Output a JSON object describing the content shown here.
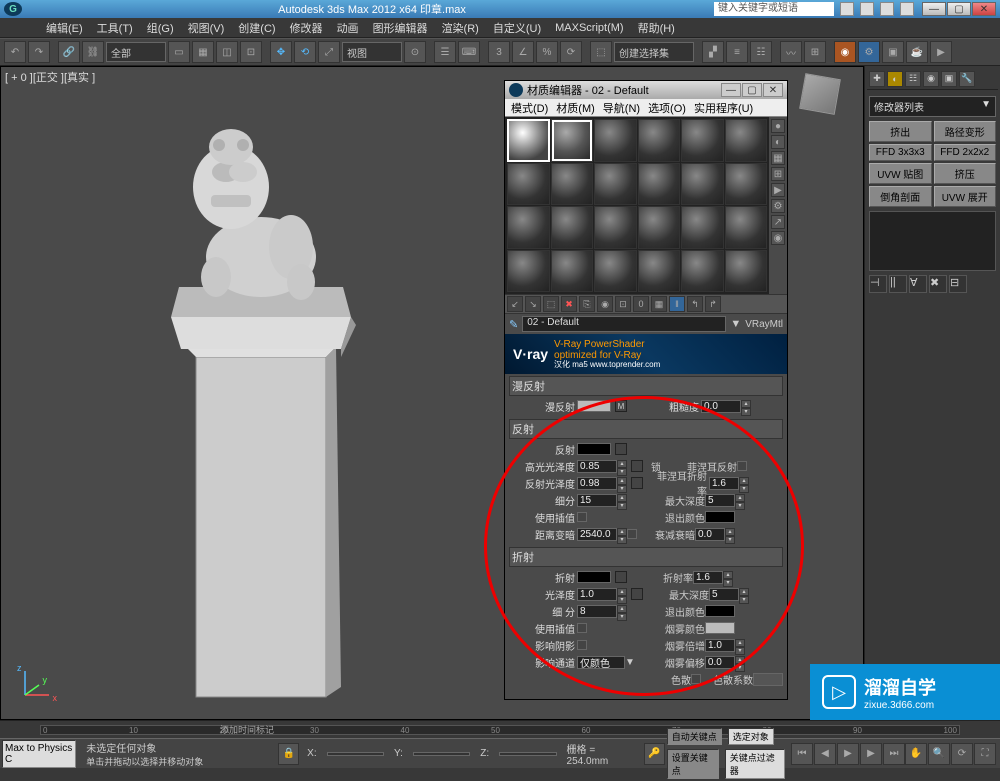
{
  "app": {
    "title": "Autodesk 3ds Max  2012 x64    印章.max",
    "search_placeholder": "键入关键字或短语"
  },
  "menubar": [
    "编辑(E)",
    "工具(T)",
    "组(G)",
    "视图(V)",
    "创建(C)",
    "修改器",
    "动画",
    "图形编辑器",
    "渲染(R)",
    "自定义(U)",
    "MAXScript(M)",
    "帮助(H)"
  ],
  "toolbar": {
    "combo1": "全部",
    "combo_view": "视图",
    "combo_select": "创建选择集"
  },
  "viewport": {
    "label": "[ + 0 ][正交 ][真实 ]"
  },
  "material_editor": {
    "title": "材质编辑器 - 02 - Default",
    "menu": [
      "模式(D)",
      "材质(M)",
      "导航(N)",
      "选项(O)",
      "实用程序(U)"
    ],
    "material_name": "02 - Default",
    "material_type": "VRayMtl",
    "vray_banner": {
      "logo": "V·ray",
      "line1": "V-Ray PowerShader",
      "line2": "optimized for V-Ray",
      "line3": "汉化 ma5 www.toprender.com"
    },
    "section_diffuse": "漫反射",
    "section_reflect": "反射",
    "section_refract": "折射",
    "params": {
      "diffuse_label": "漫反射",
      "roughness_label": "粗糙度",
      "roughness_val": "0.0",
      "reflect_label": "反射",
      "hilight_gloss_label": "高光光泽度",
      "hilight_gloss_val": "0.85",
      "lock_label": "锁",
      "fresnel_label": "菲涅耳反射",
      "refl_gloss_label": "反射光泽度",
      "refl_gloss_val": "0.98",
      "fresnel_ior_label": "菲涅耳折射率",
      "fresnel_ior_val": "1.6",
      "subdiv_label": "细分",
      "subdiv_val": "15",
      "maxdepth_label": "最大深度",
      "maxdepth_val": "5",
      "use_interp_label": "使用插值",
      "exit_color_label": "退出颜色",
      "dim_dist_label": "距离变暗",
      "dim_dist_val": "2540.0",
      "dim_falloff_label": "衰减衰暗",
      "dim_falloff_val": "0.0",
      "refract_label": "折射",
      "ior_label": "折射率",
      "ior_val": "1.6",
      "gloss_label": "光泽度",
      "gloss_val": "1.0",
      "refr_maxdepth_label": "最大深度",
      "refr_maxdepth_val": "5",
      "refr_subdiv_label": "细 分",
      "refr_subdiv_val": "8",
      "refr_exit_label": "退出颜色",
      "refr_interp_label": "使用插值",
      "fog_color_label": "烟雾颜色",
      "affect_shadow_label": "影响阴影",
      "fog_mult_label": "烟雾倍增",
      "fog_mult_val": "1.0",
      "affect_channel_label": "影响通道",
      "affect_channel_val": "仅颜色",
      "fog_bias_label": "烟雾偏移",
      "fog_bias_val": "0.0",
      "dispersion_label": "色散",
      "dispersion_abbe_label": "色散系数"
    }
  },
  "right_panel": {
    "dropdown": "修改器列表",
    "buttons": [
      "挤出",
      "路径变形",
      "FFD 3x3x3",
      "FFD 2x2x2",
      "UVW 贴图",
      "挤压",
      "倒角剖面",
      "UVW 展开"
    ]
  },
  "statusbar": {
    "script_label": "Max to Physics C",
    "no_selection": "未选定任何对象",
    "hint": "单击并拖动以选择并移动对象",
    "add_key": "添加时间标记",
    "grid": "栅格 = 254.0mm",
    "auto_key": "自动关键点",
    "selected": "选定对象",
    "set_key": "设置关键点",
    "key_filter": "关键点过滤器",
    "x_label": "X:",
    "y_label": "Y:",
    "z_label": "Z:"
  },
  "watermark": {
    "brand": "溜溜自学",
    "url": "zixue.3d66.com"
  }
}
